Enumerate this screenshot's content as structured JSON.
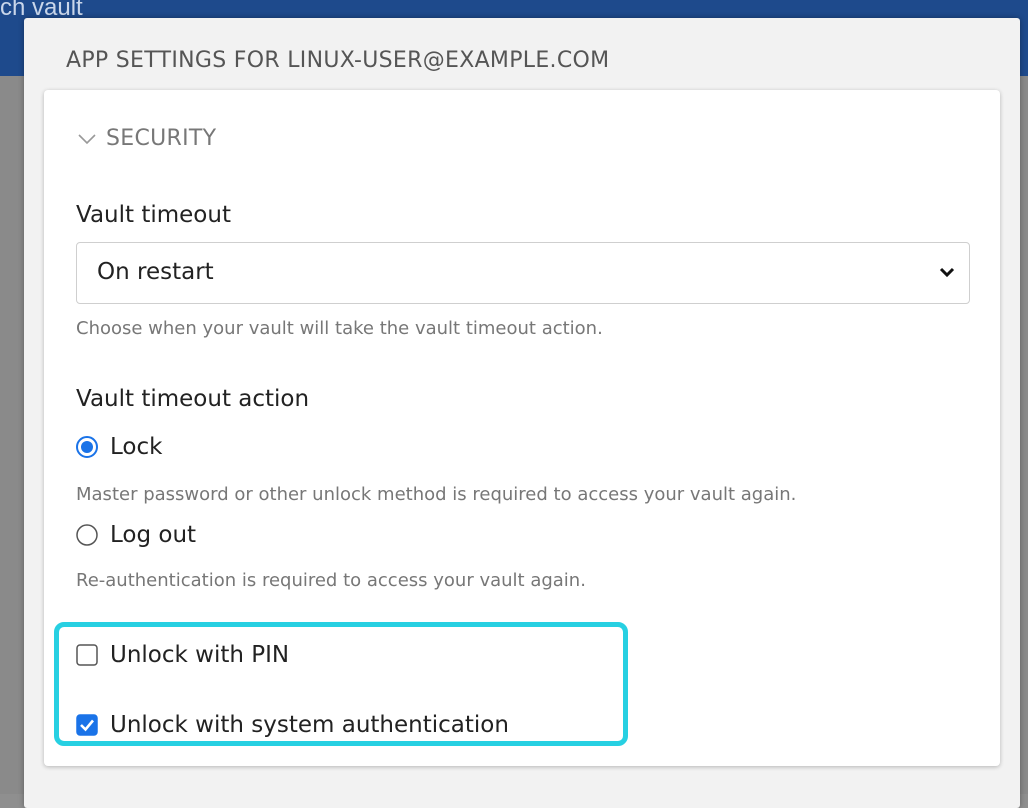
{
  "background": {
    "header_text": "ch vault",
    "header_color": "#1e4a8c"
  },
  "modal": {
    "title": "APP SETTINGS FOR LINUX-USER@EXAMPLE.COM"
  },
  "security": {
    "section_label": "SECURITY",
    "vault_timeout": {
      "label": "Vault timeout",
      "selected": "On restart",
      "help": "Choose when your vault will take the vault timeout action."
    },
    "vault_timeout_action": {
      "label": "Vault timeout action",
      "options": [
        {
          "label": "Lock",
          "selected": true,
          "help": "Master password or other unlock method is required to access your vault again."
        },
        {
          "label": "Log out",
          "selected": false,
          "help": "Re-authentication is required to access your vault again."
        }
      ]
    },
    "unlock_options": [
      {
        "label": "Unlock with PIN",
        "checked": false
      },
      {
        "label": "Unlock with system authentication",
        "checked": true
      }
    ]
  },
  "colors": {
    "accent": "#1a73e8",
    "highlight": "#27d0e2"
  }
}
